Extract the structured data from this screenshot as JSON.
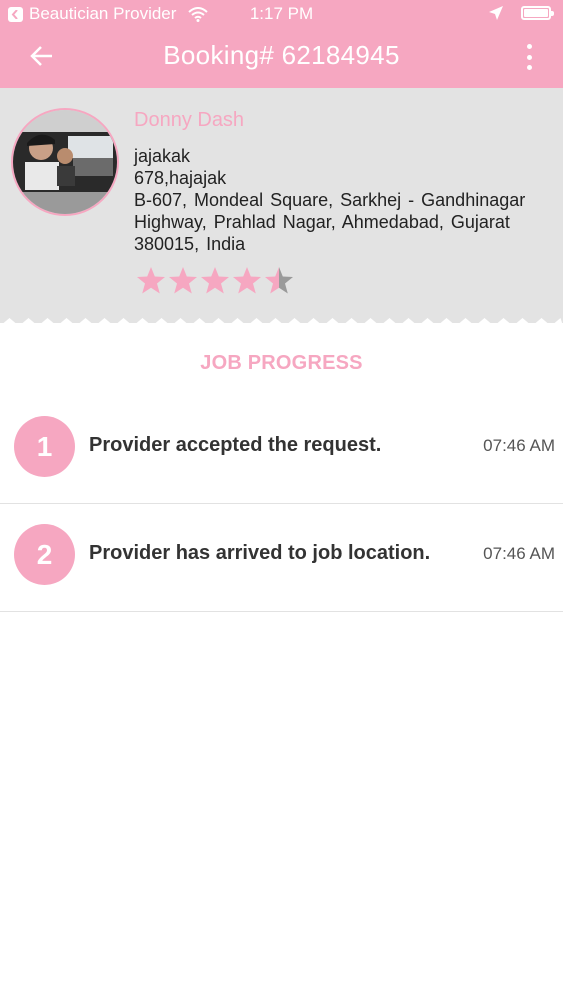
{
  "status_bar": {
    "back_app": "Beautician Provider",
    "time": "1:17 PM"
  },
  "nav": {
    "title": "Booking# 62184945"
  },
  "profile": {
    "name": "Donny Dash",
    "line1": "jajakak",
    "line2": "678,hajajak",
    "address": "B-607, Mondeal Square, Sarkhej - Gandhinagar Highway, Prahlad Nagar, Ahmedabad, Gujarat 380015, India",
    "rating": 4.5,
    "rating_max": 5
  },
  "progress": {
    "title": "JOB PROGRESS",
    "steps": [
      {
        "number": "1",
        "text": "Provider accepted the request.",
        "time": "07:46 AM"
      },
      {
        "number": "2",
        "text": "Provider has arrived to job location.",
        "time": "07:46 AM"
      }
    ]
  },
  "colors": {
    "accent": "#f6a7c1",
    "profile_bg": "#e3e3e3",
    "star_empty": "#9a9a9a"
  },
  "icons": [
    "back-arrow-icon",
    "more-vertical-icon",
    "wifi-icon",
    "location-arrow-icon",
    "battery-icon",
    "star-icon"
  ]
}
